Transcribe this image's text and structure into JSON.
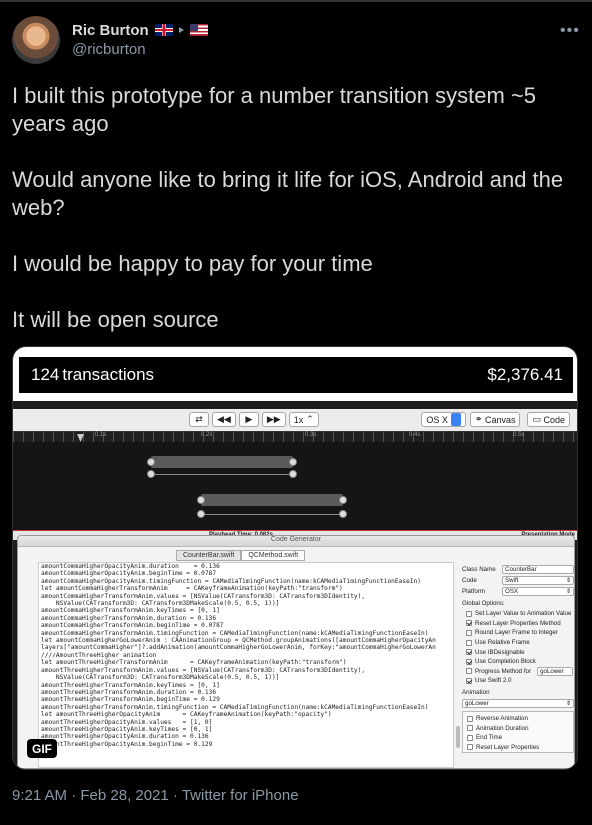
{
  "author": {
    "name": "Ric Burton",
    "handle": "@ricburton"
  },
  "icons": {
    "more": "more-horizontal-icon",
    "flag_uk": "uk-flag-icon",
    "flag_us": "us-flag-icon"
  },
  "tweet": {
    "paragraphs": [
      "I built this prototype for a number transition system ~5 years ago",
      "Would anyone like to bring it life for iOS, Android and the web?",
      "I would be happy to pay for your time",
      "It will be open source"
    ],
    "timestamp": "9:21 AM · Feb 28, 2021 · Twitter for iPhone"
  },
  "media": {
    "badge": "GIF",
    "counter": {
      "number": "124",
      "word": "transactions",
      "amount": "$2,376.41"
    },
    "toolbar": {
      "speed": "1x",
      "os": "OS X",
      "canvas": "Canvas",
      "code": "Code"
    },
    "timeline": {
      "ticks": [
        "0.1s",
        "0.2s",
        "0.3s",
        "0.4s",
        "0.5s"
      ],
      "playhead_time": "Playhead Time: 0.082s",
      "presentation_mode": "Presentation Mode"
    },
    "codegen": {
      "title": "Code Generator",
      "tabs": [
        "CounterBar.swift",
        "QCMethod.swift"
      ],
      "code_lines": [
        "amountCommaHigherOpacityAnim.duration    = 0.136",
        "amountCommaHigherOpacityAnim.beginTime = 0.0787",
        "amountCommaHigherOpacityAnim.timingFunction = CAMediaTimingFunction(name:kCAMediaTimingFunctionEaseIn)",
        "",
        "let amountCommaHigherTransformAnim     = CAKeyframeAnimation(keyPath:\"transform\")",
        "amountCommaHigherTransformAnim.values = [NSValue(CATransform3D: CATransform3DIdentity),",
        "    NSValue(CATransform3D: CATransform3DMakeScale(0.5, 0.5, 1))]",
        "amountCommaHigherTransformAnim.keyTimes = [0, 1]",
        "amountCommaHigherTransformAnim.duration = 0.136",
        "amountCommaHigherTransformAnim.beginTime = 0.0787",
        "amountCommaHigherTransformAnim.timingFunction = CAMediaTimingFunction(name:kCAMediaTimingFunctionEaseIn)",
        "",
        "let amountCommaHigherGoLowerAnim : CAAnimationGroup = QCMethod.groupAnimations([amountCommaHigherOpacityAn",
        "layers[\"amountCommaHigher\"]?.addAnimation(amountCommaHigherGoLowerAnim, forKey:\"amountCommaHigherGoLowerAn",
        "",
        "////AmountThreeHigher animation",
        "let amountThreeHigherTransformAnim      = CAKeyframeAnimation(keyPath:\"transform\")",
        "amountThreeHigherTransformAnim.values = [NSValue(CATransform3D: CATransform3DIdentity),",
        "    NSValue(CATransform3D: CATransform3DMakeScale(0.5, 0.5, 1))]",
        "amountThreeHigherTransformAnim.keyTimes = [0, 1]",
        "amountThreeHigherTransformAnim.duration = 0.136",
        "amountThreeHigherTransformAnim.beginTime = 0.129",
        "amountThreeHigherTransformAnim.timingFunction = CAMediaTimingFunction(name:kCAMediaTimingFunctionEaseIn)",
        "",
        "let amountThreeHigherOpacityAnim      = CAKeyframeAnimation(keyPath:\"opacity\")",
        "amountThreeHigherOpacityAnim.values   = [1, 0]",
        "amountThreeHigherOpacityAnim.keyTimes = [0, 1]",
        "amountThreeHigherOpacityAnim.duration = 0.136",
        "amountThreeHigherOpacityAnim.beginTime = 0.129"
      ],
      "panel": {
        "class_name_label": "Class Name",
        "class_name_value": "CounterBar",
        "code_label": "Code",
        "code_value": "Swift",
        "platform_label": "Platform",
        "platform_value": "OSX",
        "global_options_label": "Global Options:",
        "options": [
          {
            "label": "Set Layer Value to Animation Value",
            "checked": false
          },
          {
            "label": "Reset Layer Properties Method",
            "checked": true
          },
          {
            "label": "Round Layer Frame to Integer",
            "checked": false
          },
          {
            "label": "Use Relative Frame",
            "checked": false
          },
          {
            "label": "Use IBDesignable",
            "checked": true
          },
          {
            "label": "Use Completion Block",
            "checked": true
          },
          {
            "label": "Progress Method for",
            "checked": false
          },
          {
            "label": "Use Swift 2.0",
            "checked": true
          }
        ],
        "progress_method_value": "goLower",
        "animation_label": "Animation",
        "animation_value": "goLower",
        "animation_options": [
          {
            "label": "Reverse Animation",
            "checked": false
          },
          {
            "label": "Animation Duration",
            "checked": false
          },
          {
            "label": "End Time",
            "checked": false
          },
          {
            "label": "Reset Layer Properties",
            "checked": false
          }
        ]
      }
    }
  }
}
